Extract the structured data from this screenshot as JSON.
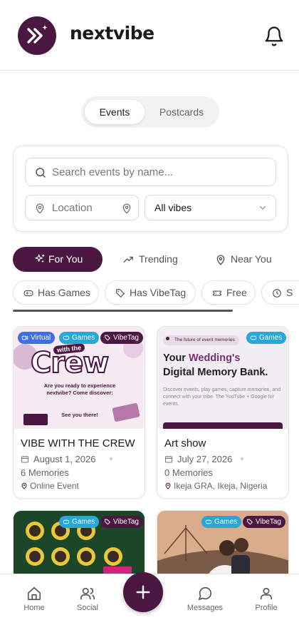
{
  "app": {
    "brand": "nextvibe",
    "accent": "#4a1741"
  },
  "header": {
    "logo_icon": "fast-forward-star-icon",
    "bell_icon": "bell-icon"
  },
  "segment": {
    "options": [
      "Events",
      "Postcards"
    ],
    "selected": "Events"
  },
  "search": {
    "placeholder": "Search events by name...",
    "location_placeholder": "Location",
    "vibe_select_value": "All vibes"
  },
  "tabs": [
    {
      "label": "For You",
      "icon": "sparkles-icon",
      "active": true
    },
    {
      "label": "Trending",
      "icon": "trending-up-icon",
      "active": false
    },
    {
      "label": "Near You",
      "icon": "map-pin-icon",
      "active": false
    }
  ],
  "chips": [
    {
      "label": "Has Games",
      "icon": "gamepad-icon"
    },
    {
      "label": "Has VibeTag",
      "icon": "tag-icon"
    },
    {
      "label": "Free",
      "icon": "ticket-icon"
    },
    {
      "label": "S",
      "icon": "clock-icon"
    }
  ],
  "events": [
    {
      "title": "VIBE WITH THE CREW",
      "date": "August 1, 2026",
      "memories": "6 Memories",
      "location": "Online Event",
      "badges": [
        "Virtual",
        "Games",
        "VibeTag"
      ],
      "thumb": {
        "line1": "with the",
        "line2": "Crew",
        "line3": "Are you ready to experience",
        "line4": "nextvibe? Come discover:",
        "line5": "See you there!"
      }
    },
    {
      "title": "Art show",
      "date": "July 27, 2026",
      "memories": "0 Memories",
      "location": "Ikeja GRA, Ikeja, Nigeria",
      "badges": [
        "Games"
      ],
      "thumb": {
        "tagline": "The future of event memories",
        "headline_1": "Your ",
        "headline_accent": "Wedding's",
        "headline_2": "Digital Memory Bank.",
        "body": "Discover events, play games, capture memories, and connect with your tribe. The YouTube + Google for events."
      }
    },
    {
      "badges": [
        "Games",
        "VibeTag"
      ]
    },
    {
      "badges": [
        "Games",
        "VibeTag"
      ]
    }
  ],
  "bottom_nav": [
    {
      "label": "Home",
      "icon": "home-icon"
    },
    {
      "label": "Social",
      "icon": "users-icon"
    },
    {
      "label": "Messages",
      "icon": "message-circle-icon"
    },
    {
      "label": "Profile",
      "icon": "user-icon"
    }
  ],
  "fab_icon": "plus-icon"
}
